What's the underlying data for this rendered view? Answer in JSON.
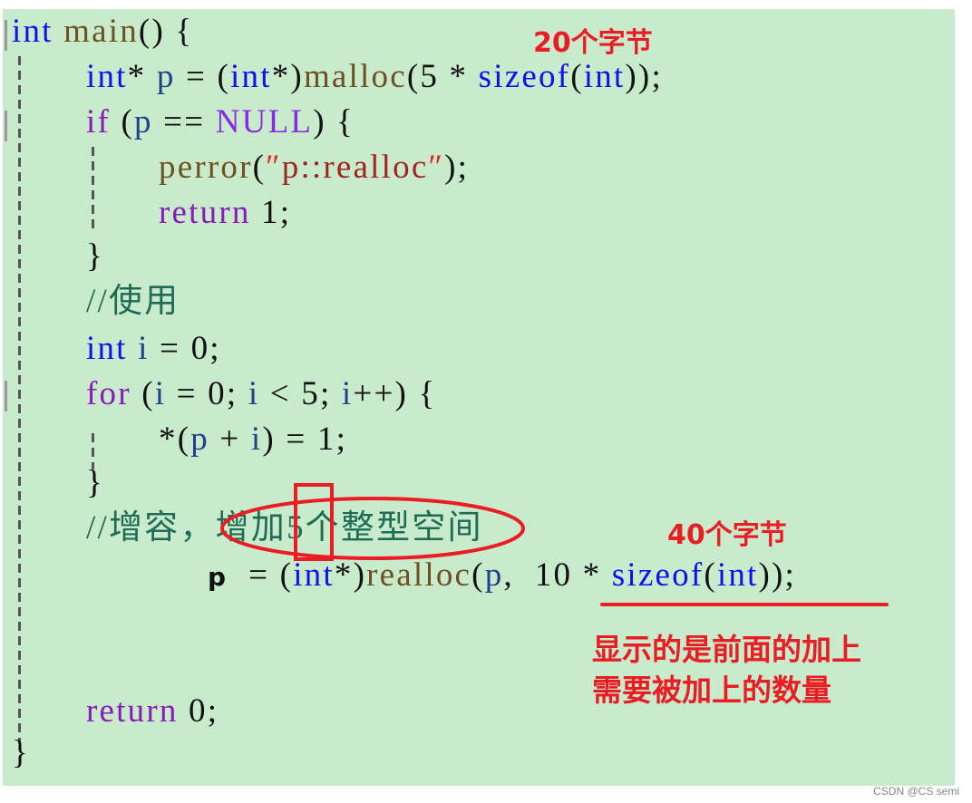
{
  "code": {
    "line1": {
      "kw": "int",
      "fn": "main",
      "rest": "() {"
    },
    "line2": {
      "kw1": "int",
      "star": "* ",
      "var": "p",
      "eq": " = (",
      "kw2": "int",
      "cast": "*)",
      "fn": "malloc",
      "open": "(5 * ",
      "kw3": "sizeof",
      "p1": "(",
      "kw4": "int",
      "close": "));"
    },
    "line3": {
      "kw": "if",
      "open": " (",
      "var": "p",
      "eq": " == ",
      "macro": "NULL",
      "close": ") {"
    },
    "line4": {
      "fn": "perror",
      "open": "(",
      "q1": "″",
      "str": "p::realloc",
      "q2": "″",
      "close": ");"
    },
    "line5": {
      "kw": "return",
      "rest": " 1;"
    },
    "line6": {
      "rest": "}"
    },
    "line7": {
      "comment": "//使用"
    },
    "line8": {
      "kw": "int",
      "var": " i",
      "rest": " = 0;"
    },
    "line9": {
      "kw": "for",
      "o1": " (",
      "v1": "i",
      "m1": " = 0; ",
      "v2": "i",
      "m2": " < 5; ",
      "v3": "i",
      "m3": "++) {"
    },
    "line10": {
      "star": "*(",
      "v1": "p",
      "plus": " + ",
      "v2": "i",
      "rest": ") = 1;"
    },
    "line11": {
      "rest": "}"
    },
    "line12": {
      "comment": "//增容，增加5个整型空间"
    },
    "line13": {
      "p": "p",
      "eq": "  = (",
      "kw": "int",
      "cast": "*)",
      "fn": "realloc",
      "open": "(",
      "var": "p",
      "comma": ",  10 * ",
      "kw2": "sizeof",
      "p1": "(",
      "kw3": "int",
      "close": "));"
    },
    "line14": {
      "kw": "return",
      "rest": " 0;"
    },
    "line15": {
      "rest": "}"
    }
  },
  "annotations": {
    "bytes20": "20个字节",
    "bytes40": "40个字节",
    "note_line1": "显示的是前面的加上",
    "note_line2": "需要被加上的数量",
    "annotation_color": "#ea1d25"
  },
  "watermark": "CSDN @CS semi"
}
